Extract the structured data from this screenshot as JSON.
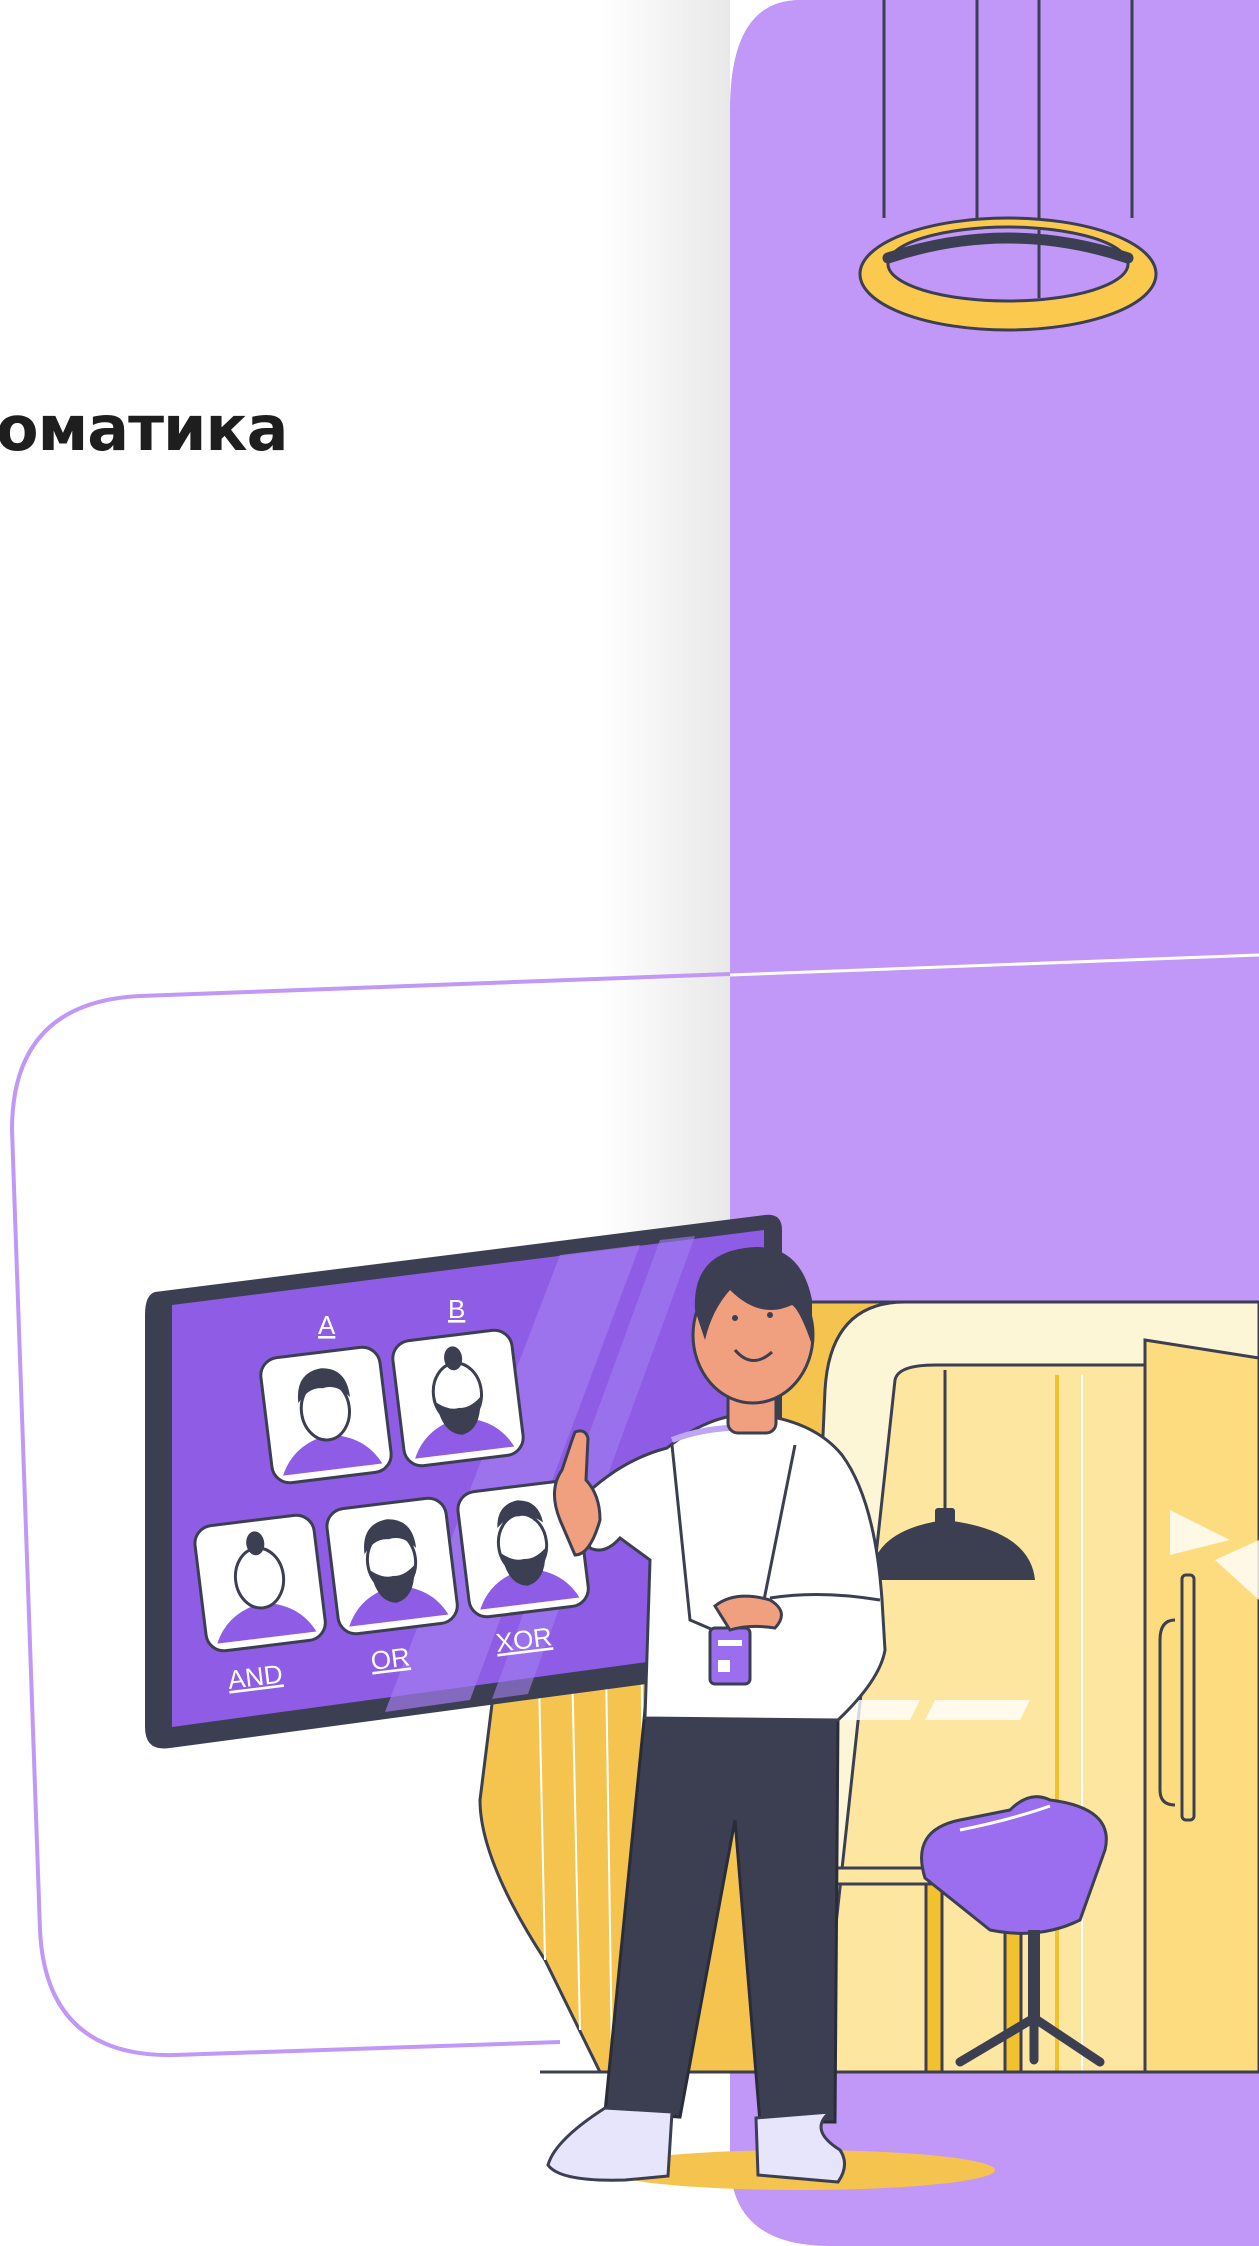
{
  "heading": {
    "text": "оматика"
  },
  "board": {
    "label_a": "A",
    "label_b": "B",
    "label_and": "AND",
    "label_or": "OR",
    "label_xor": "XOR"
  },
  "colors": {
    "accent_purple": "#c197f8",
    "board_purple": "#8f5ce6",
    "ink": "#3c3f52",
    "ring_yellow": "#fac94e",
    "booth_orange": "#f4c44f",
    "room_yellow": "#fbe79a"
  },
  "icons": {
    "ring_lamp": "ring-lamp-icon",
    "pendant_lamp": "pendant-lamp-icon",
    "badge": "badge-icon"
  }
}
